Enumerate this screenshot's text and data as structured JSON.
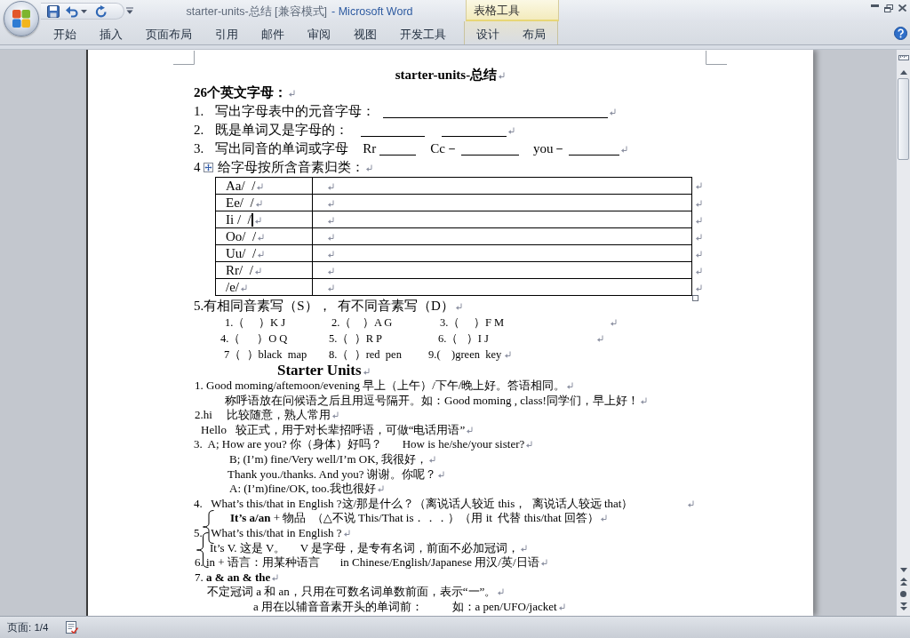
{
  "window": {
    "document_name": "starter-units-总结 [兼容模式]",
    "app_name": "- Microsoft Word"
  },
  "ribbon": {
    "tabs": [
      {
        "label": "开始",
        "selected": false
      },
      {
        "label": "插入",
        "selected": false
      },
      {
        "label": "页面布局",
        "selected": false
      },
      {
        "label": "引用",
        "selected": false
      },
      {
        "label": "邮件",
        "selected": false
      },
      {
        "label": "审阅",
        "selected": false
      },
      {
        "label": "视图",
        "selected": false
      },
      {
        "label": "开发工具",
        "selected": false
      }
    ],
    "table_tools": {
      "label": "表格工具",
      "tabs": [
        {
          "label": "设计",
          "selected": false
        },
        {
          "label": "布局",
          "selected": false
        }
      ]
    }
  },
  "document": {
    "show_formatting_marks": true,
    "title": "starter-units-总结",
    "heading": "26个英文字母：",
    "questions": [
      {
        "number": "1.",
        "segments": [
          {
            "kind": "text",
            "text": "写出字母表中的元音字母："
          },
          {
            "kind": "blank"
          }
        ]
      },
      {
        "number": "2.",
        "segments": [
          {
            "kind": "text",
            "text": "既是单词又是字母的："
          },
          {
            "kind": "blank"
          },
          {
            "kind": "blank"
          }
        ]
      },
      {
        "number": "3.",
        "segments": [
          {
            "kind": "text",
            "text": "写出同音的单词或字母"
          },
          {
            "kind": "text",
            "text": "Rr"
          },
          {
            "kind": "blank"
          },
          {
            "kind": "text",
            "text": "Cc－"
          },
          {
            "kind": "blank"
          },
          {
            "kind": "text",
            "text": "you－"
          },
          {
            "kind": "blank"
          }
        ]
      },
      {
        "number": "4",
        "segments": [
          {
            "kind": "handle"
          },
          {
            "kind": "text",
            "text": "给字母按所含音素归类："
          }
        ]
      }
    ],
    "table": {
      "rows": [
        {
          "label": "Aa/  /",
          "caret": false
        },
        {
          "label": "Ee/  /",
          "caret": false
        },
        {
          "label": "Ii /  /",
          "caret": true
        },
        {
          "label": "Oo/  /",
          "caret": false
        },
        {
          "label": "Uu/  /",
          "caret": false
        },
        {
          "label": "Rr/  /",
          "caret": false
        },
        {
          "label": "/e/",
          "caret": false
        }
      ]
    },
    "exercise": {
      "instruction": "5.有相同音素写（S），  有不同音素写（D）",
      "rows": [
        {
          "items": [
            "1.（     ）K J",
            "2.（    ）A G",
            "3.（     ）F M"
          ]
        },
        {
          "items": [
            "4.（      ）O Q",
            "5.（  ）R P",
            "6.（   ）I J"
          ]
        },
        {
          "items": [
            "7（  ）black  map",
            "8.（  ）red  pen",
            "9.(    )green  key"
          ]
        }
      ]
    },
    "notes_title": "Starter Units",
    "notes": [
      "1. Good moming/aftemoon/evening 早上（上午）/下午/晚上好。答语相同。",
      "称呼语放在问候语之后且用逗号隔开。如：Good moming , class!同学们，早上好！",
      "2.hi     比较随意，熟人常用",
      "Hello   较正式，用于对长辈招呼语，可做“电话用语”",
      "3.  A; How are you? 你（身体）好吗？       How is he/she/your sister?",
      "B; (I’m) fine/Very well/I’m OK, 我很好，",
      "Thank you./thanks. And you? 谢谢。你呢？",
      "A: (I’m)fine/OK, too.我也很好",
      "4.   What’s this/that in English ?这/那是什么？（离说话人较近 this，  离说话人较远 that）",
      "**It’s a/an** + 物品  （△不说 This/That is．．．）（用 it  代替 this/that 回答）",
      "5.   What’s this/that in English ?",
      "It’s V. 这是 V。     V 是字母，是专有名词，前面不必加冠词，",
      "6. in + 语言：用某种语言       in Chinese/English/Japanese 用汉/英/日语",
      "7. **a & an & the**",
      "不定冠词 a 和 an，只用在可数名词单数前面，表示“一”。",
      "a 用在以辅音音素开头的单词前：          如：a pen/UFO/jacket"
    ]
  },
  "status_bar": {
    "page": "页面: 1/4"
  }
}
